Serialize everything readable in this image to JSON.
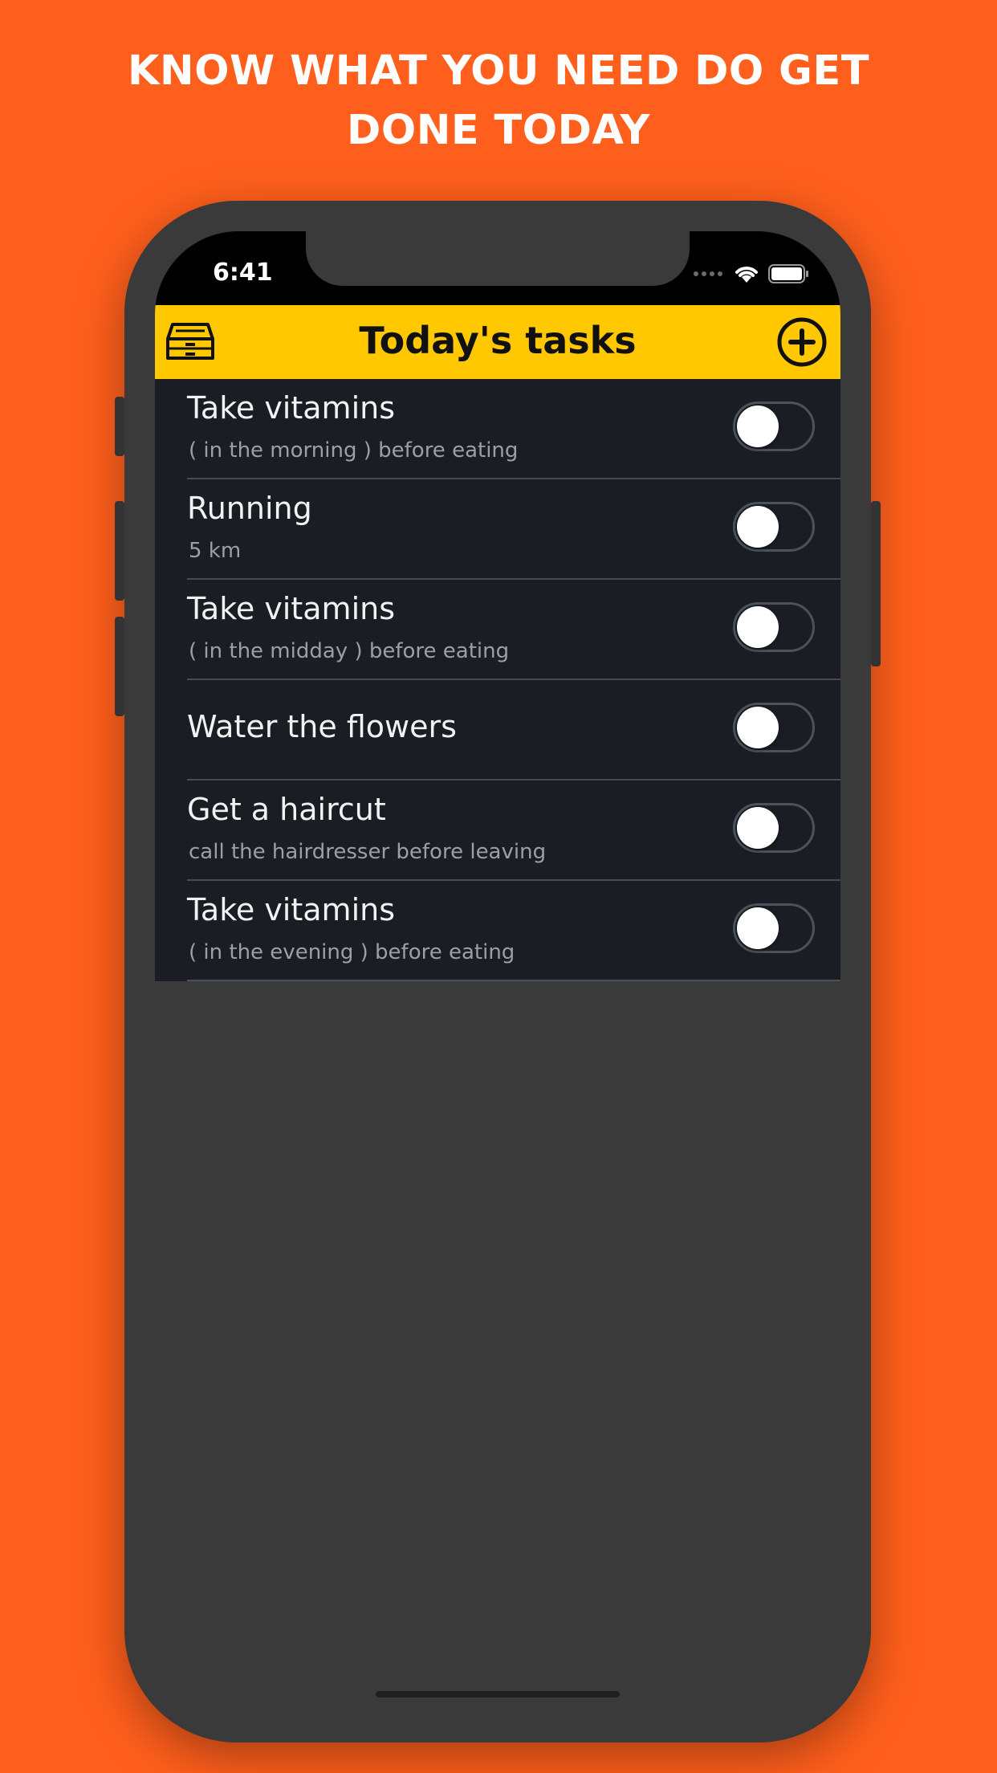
{
  "headline": {
    "line1": "KNOW WHAT YOU NEED DO GET",
    "line2": "DONE TODAY"
  },
  "status_bar": {
    "time": "6:41",
    "icons": [
      "signal-dots-icon",
      "wifi-icon",
      "battery-icon"
    ]
  },
  "nav": {
    "title": "Today's tasks",
    "left_icon": "inbox-tray-icon",
    "right_icon": "plus-circle-icon"
  },
  "tasks": [
    {
      "title": "Take vitamins",
      "subtitle": "( in the morning ) before eating",
      "done": false
    },
    {
      "title": "Running",
      "subtitle": "5 km",
      "done": false
    },
    {
      "title": "Take vitamins",
      "subtitle": "( in the midday ) before eating",
      "done": false
    },
    {
      "title": "Water the flowers",
      "subtitle": "",
      "done": false
    },
    {
      "title": "Get a haircut",
      "subtitle": "call the hairdresser before leaving",
      "done": false
    },
    {
      "title": "Take vitamins",
      "subtitle": "( in the evening ) before eating",
      "done": false
    }
  ],
  "colors": {
    "background": "#ff5f1c",
    "nav_bar": "#ffc800",
    "list_background": "#1a1e24",
    "phone_body": "#3a3a3a"
  }
}
